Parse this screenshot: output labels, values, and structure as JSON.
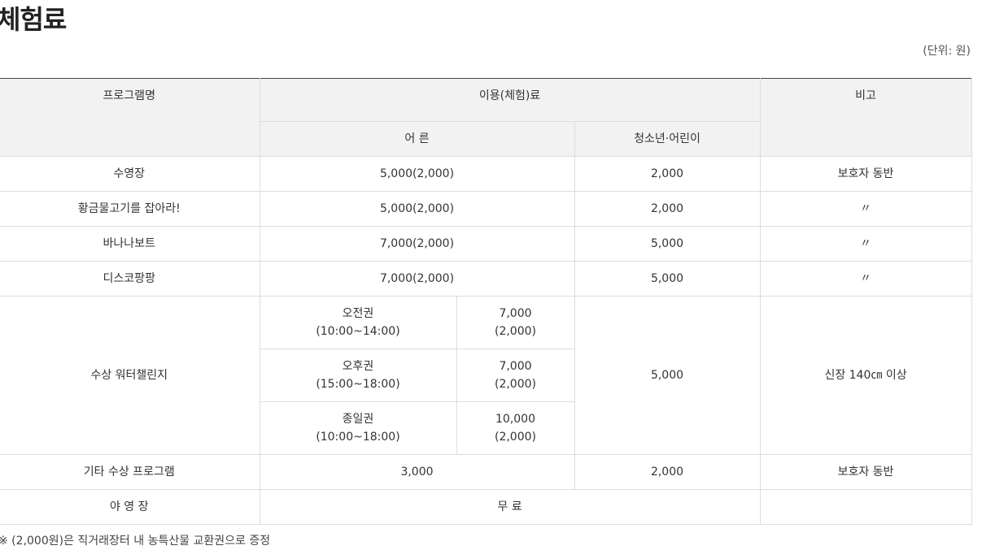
{
  "page": {
    "title": "체험료",
    "unit_note": "(단위: 원)",
    "footnote": "※ (2,000원)은 직거래장터 내 농특산물 교환권으로 증정"
  },
  "table": {
    "headers": {
      "program": "프로그램명",
      "fee": "이용(체험)료",
      "note": "비고",
      "adult": "어 른",
      "youth": "청소년·어린이"
    },
    "rows": [
      {
        "program": "수영장",
        "adult": "5,000(2,000)",
        "youth": "2,000",
        "note": "보호자 동반"
      },
      {
        "program": "황금물고기를 잡아라!",
        "adult": "5,000(2,000)",
        "youth": "2,000",
        "note": "〃"
      },
      {
        "program": "바나나보트",
        "adult": "7,000(2,000)",
        "youth": "5,000",
        "note": "〃"
      },
      {
        "program": "디스코팡팡",
        "adult": "7,000(2,000)",
        "youth": "5,000",
        "note": "〃"
      }
    ],
    "water_challenge": {
      "program": "수상 워터챌린지",
      "youth": "5,000",
      "note": "신장 140㎝ 이상",
      "tickets": [
        {
          "name": "오전권",
          "time": "(10:00~14:00)",
          "price": "7,000",
          "bonus": "(2,000)"
        },
        {
          "name": "오후권",
          "time": "(15:00~18:00)",
          "price": "7,000",
          "bonus": "(2,000)"
        },
        {
          "name": "종일권",
          "time": "(10:00~18:00)",
          "price": "10,000",
          "bonus": "(2,000)"
        }
      ]
    },
    "other": {
      "program": "기타 수상 프로그램",
      "adult": "3,000",
      "youth": "2,000",
      "note": "보호자 동반"
    },
    "camping": {
      "program": "야 영 장",
      "fee": "무 료",
      "note": ""
    }
  }
}
